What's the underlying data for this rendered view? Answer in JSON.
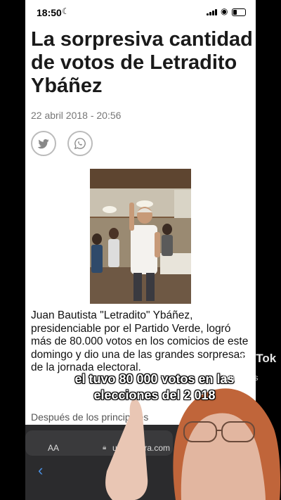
{
  "status_bar": {
    "time": "18:50"
  },
  "article": {
    "headline": "La sorpresiva cantidad de votos de Letradito Ybáñez",
    "date": "22 abril 2018 - 20:56",
    "body": "Juan Bautista \"Letradito\" Ybáñez, presidenciable por el Partido Verde, logró más de 80.000 votos en los comicios de este domingo y dio una de las grandes sorpresas de la jornada electoral.",
    "teaser": "Después de los principales"
  },
  "browser": {
    "text_size_label": "AA",
    "url": "ultimahora.com"
  },
  "overlay": {
    "caption_line1": "el tuvo 80 000 votos en las",
    "caption_line2": "elecciones del 2 018",
    "watermark": "TikTok",
    "handle": "@ida.lliss"
  }
}
